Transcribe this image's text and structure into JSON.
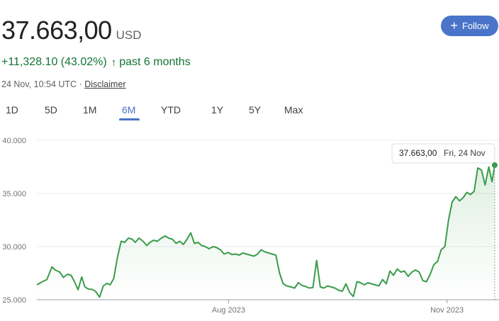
{
  "quote": {
    "price": "37.663,00",
    "currency": "USD",
    "change": "+11,328.10 (43.02%)",
    "change_arrow": "↑",
    "period": "past 6 months",
    "timestamp": "24 Nov, 10:54 UTC",
    "separator": "·",
    "disclaimer": "Disclaimer"
  },
  "follow": {
    "icon": "plus-icon",
    "glyph": "+",
    "label": "Follow"
  },
  "tabs": [
    {
      "label": "1D"
    },
    {
      "label": "5D"
    },
    {
      "label": "1M"
    },
    {
      "label": "6M",
      "active": true
    },
    {
      "label": "YTD"
    },
    {
      "label": "1Y"
    },
    {
      "label": "5Y"
    },
    {
      "label": "Max"
    }
  ],
  "colors": {
    "line": "#3a9c4a",
    "accent": "#4a74c9",
    "positive": "#137333",
    "grid": "#ececec"
  },
  "chart_data": {
    "type": "area",
    "ylim": [
      25000,
      40000
    ],
    "yticks": [
      {
        "value": 40000,
        "label": "40.000"
      },
      {
        "value": 35000,
        "label": "35.000"
      },
      {
        "value": 30000,
        "label": "30.000"
      },
      {
        "value": 25000,
        "label": "25.000"
      }
    ],
    "xticks": [
      {
        "x": 0.4186,
        "label": "Aug 2023"
      },
      {
        "x": 0.8957,
        "label": "Nov 2023"
      }
    ],
    "tooltip": {
      "value": "37.663,00",
      "date": "Fri, 24 Nov"
    },
    "x": [
      0,
      0.012,
      0.022,
      0.033,
      0.04,
      0.05,
      0.058,
      0.067,
      0.075,
      0.082,
      0.09,
      0.098,
      0.105,
      0.113,
      0.12,
      0.128,
      0.137,
      0.145,
      0.153,
      0.16,
      0.168,
      0.176,
      0.184,
      0.192,
      0.2,
      0.208,
      0.215,
      0.223,
      0.232,
      0.24,
      0.247,
      0.255,
      0.263,
      0.272,
      0.28,
      0.288,
      0.296,
      0.304,
      0.312,
      0.32,
      0.328,
      0.336,
      0.344,
      0.352,
      0.36,
      0.368,
      0.376,
      0.385,
      0.393,
      0.401,
      0.409,
      0.418,
      0.426,
      0.434,
      0.442,
      0.45,
      0.458,
      0.466,
      0.474,
      0.482,
      0.49,
      0.498,
      0.506,
      0.514,
      0.522,
      0.53,
      0.538,
      0.546,
      0.555,
      0.563,
      0.571,
      0.579,
      0.587,
      0.595,
      0.603,
      0.611,
      0.619,
      0.627,
      0.635,
      0.643,
      0.651,
      0.659,
      0.667,
      0.675,
      0.683,
      0.691,
      0.699,
      0.707,
      0.715,
      0.723,
      0.731,
      0.739,
      0.747,
      0.755,
      0.763,
      0.771,
      0.779,
      0.787,
      0.795,
      0.803,
      0.811,
      0.819,
      0.827,
      0.835,
      0.843,
      0.851,
      0.859,
      0.867,
      0.875,
      0.883,
      0.891,
      0.899,
      0.907,
      0.915,
      0.923,
      0.931,
      0.939,
      0.947,
      0.955,
      0.963,
      0.971,
      0.979,
      0.987,
      0.994,
      1.0
    ],
    "values": [
      26400,
      26700,
      26900,
      28100,
      27800,
      27600,
      27100,
      27400,
      27300,
      26700,
      25950,
      27150,
      26200,
      26000,
      25980,
      25800,
      25250,
      26300,
      26550,
      26400,
      27000,
      29000,
      30500,
      30400,
      30800,
      30700,
      30400,
      30800,
      30500,
      30100,
      30400,
      30600,
      30500,
      30800,
      31000,
      30800,
      30700,
      30300,
      30500,
      30200,
      30700,
      31300,
      30300,
      30400,
      30100,
      30000,
      29800,
      30000,
      29900,
      29700,
      29300,
      29450,
      29250,
      29300,
      29200,
      29400,
      29300,
      29200,
      29100,
      29300,
      29700,
      29500,
      29400,
      29300,
      29200,
      27500,
      26500,
      26300,
      26200,
      26100,
      26600,
      26350,
      26250,
      26100,
      26150,
      28700,
      26200,
      26100,
      26300,
      26200,
      26100,
      25900,
      25800,
      26500,
      25700,
      25300,
      26700,
      26600,
      26400,
      26600,
      26500,
      26400,
      26300,
      26900,
      26500,
      27700,
      27300,
      27900,
      27600,
      27700,
      27200,
      27600,
      27800,
      27600,
      26800,
      26700,
      27400,
      28300,
      28600,
      29700,
      30000,
      32500,
      34200,
      34700,
      34300,
      34600,
      35100,
      34900,
      35200,
      37400,
      37200,
      35800,
      37500,
      36100,
      37663
    ]
  }
}
